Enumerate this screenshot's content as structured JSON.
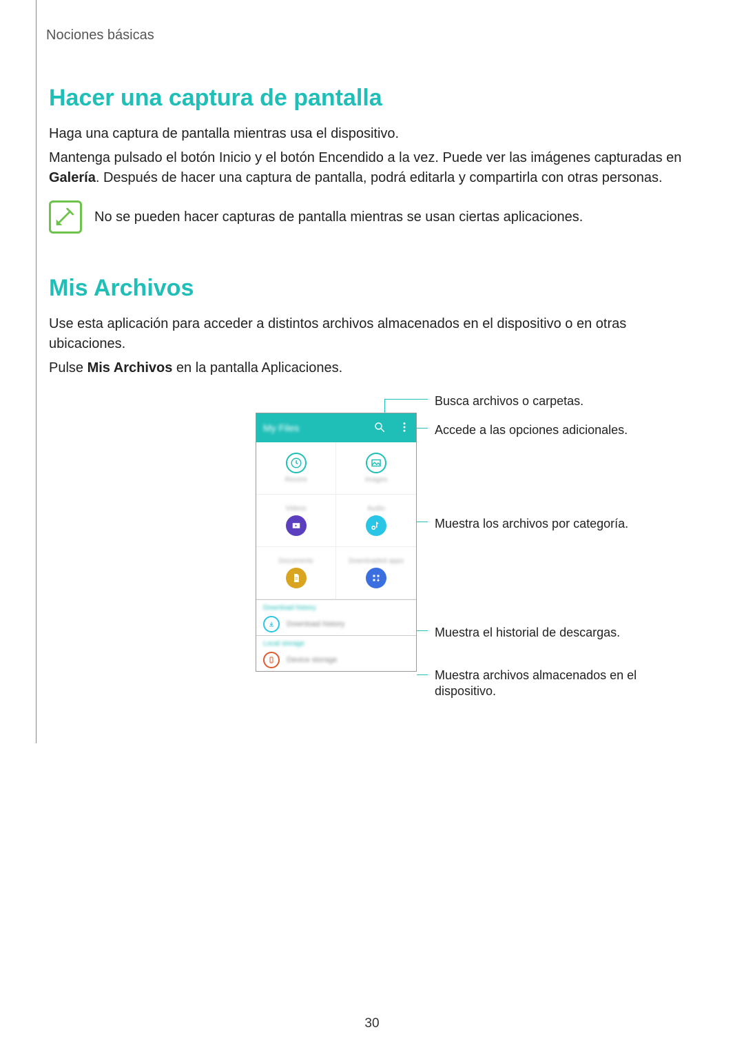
{
  "header": {
    "section": "Nociones básicas"
  },
  "s1": {
    "title": "Hacer una captura de pantalla",
    "p1": "Haga una captura de pantalla mientras usa el dispositivo.",
    "p2a": "Mantenga pulsado el botón Inicio y el botón Encendido a la vez. Puede ver las imágenes capturadas en ",
    "p2b": "Galería",
    "p2c": ". Después de hacer una captura de pantalla, podrá editarla y compartirla con otras personas.",
    "note": "No se pueden hacer capturas de pantalla mientras se usan ciertas aplicaciones."
  },
  "s2": {
    "title": "Mis Archivos",
    "p1": "Use esta aplicación para acceder a distintos archivos almacenados en el dispositivo o en otras ubicaciones.",
    "p2a": "Pulse ",
    "p2b": "Mis Archivos",
    "p2c": " en la pantalla Aplicaciones."
  },
  "callouts": {
    "c1": "Busca archivos o carpetas.",
    "c2": "Accede a las opciones adicionales.",
    "c3": "Muestra los archivos por categoría.",
    "c4": "Muestra el historial de descargas.",
    "c5": "Muestra archivos almacenados en el dispositivo."
  },
  "phone": {
    "title": "My Files",
    "cells": {
      "a": "Recent",
      "b": "Images",
      "c": "Videos",
      "d": "Audio",
      "e": "Documents",
      "f": "Downloaded apps"
    },
    "dl_hdr": "Download history",
    "dl_row": "Download history",
    "ls_hdr": "Local storage",
    "ls_row": "Device storage"
  },
  "page_number": "30"
}
